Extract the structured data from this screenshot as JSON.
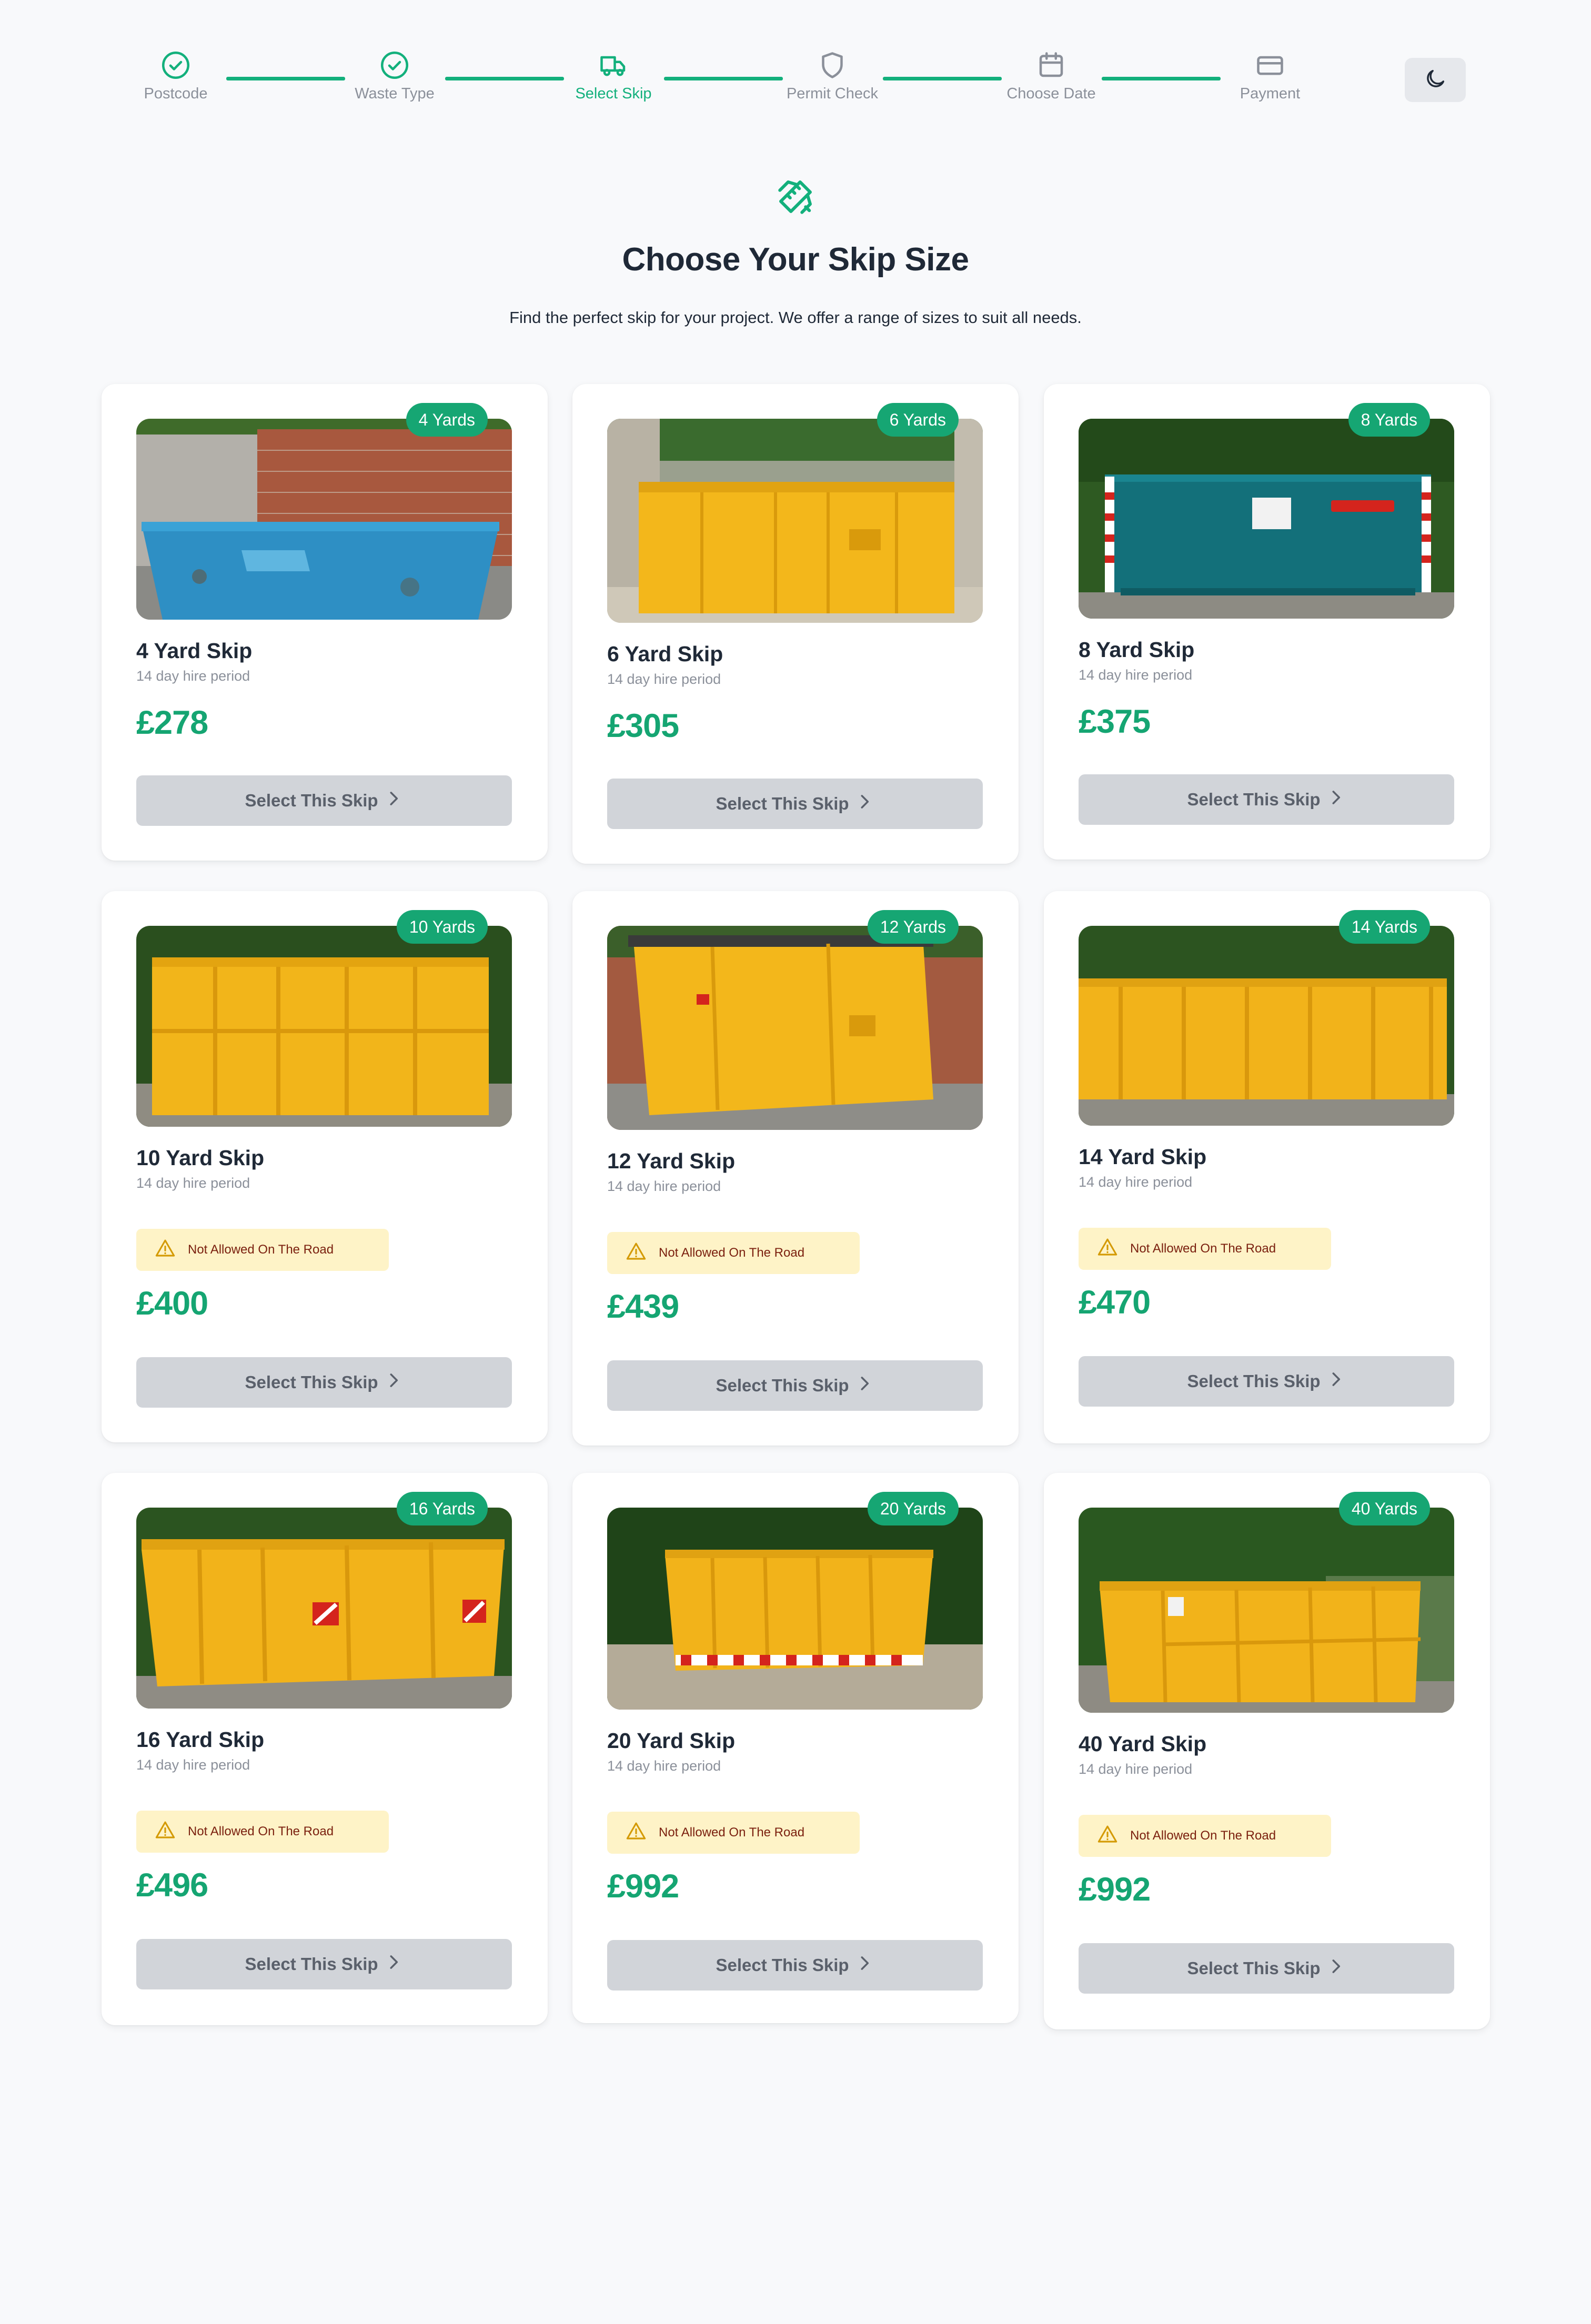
{
  "stepper": {
    "steps": [
      {
        "label": "Postcode",
        "state": "done",
        "icon": "check-circle-icon"
      },
      {
        "label": "Waste Type",
        "state": "done",
        "icon": "check-circle-icon"
      },
      {
        "label": "Select Skip",
        "state": "active",
        "icon": "truck-icon"
      },
      {
        "label": "Permit Check",
        "state": "pending",
        "icon": "shield-icon"
      },
      {
        "label": "Choose Date",
        "state": "pending",
        "icon": "calendar-icon"
      },
      {
        "label": "Payment",
        "state": "pending",
        "icon": "credit-card-icon"
      }
    ],
    "theme_toggle_icon": "moon-icon"
  },
  "header": {
    "icon": "pencil-ruler-icon",
    "title": "Choose Your Skip Size",
    "subtitle": "Find the perfect skip for your project. We offer a range of sizes to suit all needs."
  },
  "skips": [
    {
      "badge": "4 Yards",
      "name": "4 Yard Skip",
      "period": "14 day hire period",
      "price": "£278",
      "road_warning": false,
      "button": "Select This Skip",
      "image": "blue-skip-photo"
    },
    {
      "badge": "6 Yards",
      "name": "6 Yard Skip",
      "period": "14 day hire period",
      "price": "£305",
      "road_warning": false,
      "button": "Select This Skip",
      "image": "yellow-skip-photo"
    },
    {
      "badge": "8 Yards",
      "name": "8 Yard Skip",
      "period": "14 day hire period",
      "price": "£375",
      "road_warning": false,
      "button": "Select This Skip",
      "image": "teal-skip-photo"
    },
    {
      "badge": "10 Yards",
      "name": "10 Yard Skip",
      "period": "14 day hire period",
      "price": "£400",
      "road_warning": true,
      "warning": "Not Allowed On The Road",
      "button": "Select This Skip",
      "image": "yellow-skip-photo"
    },
    {
      "badge": "12 Yards",
      "name": "12 Yard Skip",
      "period": "14 day hire period",
      "price": "£439",
      "road_warning": true,
      "warning": "Not Allowed On The Road",
      "button": "Select This Skip",
      "image": "yellow-skip-photo"
    },
    {
      "badge": "14 Yards",
      "name": "14 Yard Skip",
      "period": "14 day hire period",
      "price": "£470",
      "road_warning": true,
      "warning": "Not Allowed On The Road",
      "button": "Select This Skip",
      "image": "yellow-skip-photo"
    },
    {
      "badge": "16 Yards",
      "name": "16 Yard Skip",
      "period": "14 day hire period",
      "price": "£496",
      "road_warning": true,
      "warning": "Not Allowed On The Road",
      "button": "Select This Skip",
      "image": "yellow-skip-photo"
    },
    {
      "badge": "20 Yards",
      "name": "20 Yard Skip",
      "period": "14 day hire period",
      "price": "£992",
      "road_warning": true,
      "warning": "Not Allowed On The Road",
      "button": "Select This Skip",
      "image": "yellow-skip-photo"
    },
    {
      "badge": "40 Yards",
      "name": "40 Yard Skip",
      "period": "14 day hire period",
      "price": "£992",
      "road_warning": true,
      "warning": "Not Allowed On The Road",
      "button": "Select This Skip",
      "image": "yellow-skip-photo"
    }
  ],
  "colors": {
    "accent": "#13b07c",
    "price": "#15a572",
    "warning_bg": "#fef3c7",
    "button_bg": "#d1d4d9"
  }
}
